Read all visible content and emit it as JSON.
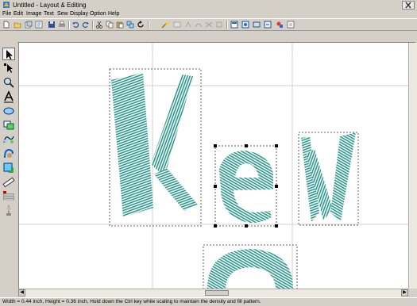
{
  "window": {
    "title": "Untitled - Layout & Editing"
  },
  "menu": [
    "File",
    "Edit",
    "Image",
    "Text",
    "Sew",
    "Display",
    "Option",
    "Help"
  ],
  "toolbar_icons": [
    "new-icon",
    "open-icon",
    "import-icon",
    "template-icon",
    "save-icon",
    "print-icon",
    "undo-icon",
    "redo-icon",
    "cut-icon",
    "copy-icon",
    "paste-icon",
    "duplicate-icon",
    "rotate-icon",
    "wizard-icon",
    "image-icon",
    "outline-icon",
    "trace-icon",
    "stitch-icon",
    "settings-icon",
    "view-icon",
    "preview-icon",
    "hoop-icon",
    "design-center-icon",
    "options-icon",
    "property-icon"
  ],
  "tools": [
    "select-icon",
    "point-edit-icon",
    "zoom-icon",
    "text-icon",
    "ellipse-icon",
    "rectangle-icon",
    "outline-shape-icon",
    "manual-punch-icon",
    "stitch-shape-icon",
    "measure-icon",
    "pattern-icon",
    "embroidery-icon"
  ],
  "colors": {
    "stitch": "#1a8a80",
    "canvas": "#ffffff",
    "chrome": "#d4d0c8"
  },
  "design": {
    "letters": [
      "K",
      "e",
      "N",
      "o"
    ]
  },
  "status": {
    "text": "Width = 0.44 inch, Height = 0.36 inch, Hold down the Ctrl key while scaling to maintain the density and fill pattern."
  }
}
